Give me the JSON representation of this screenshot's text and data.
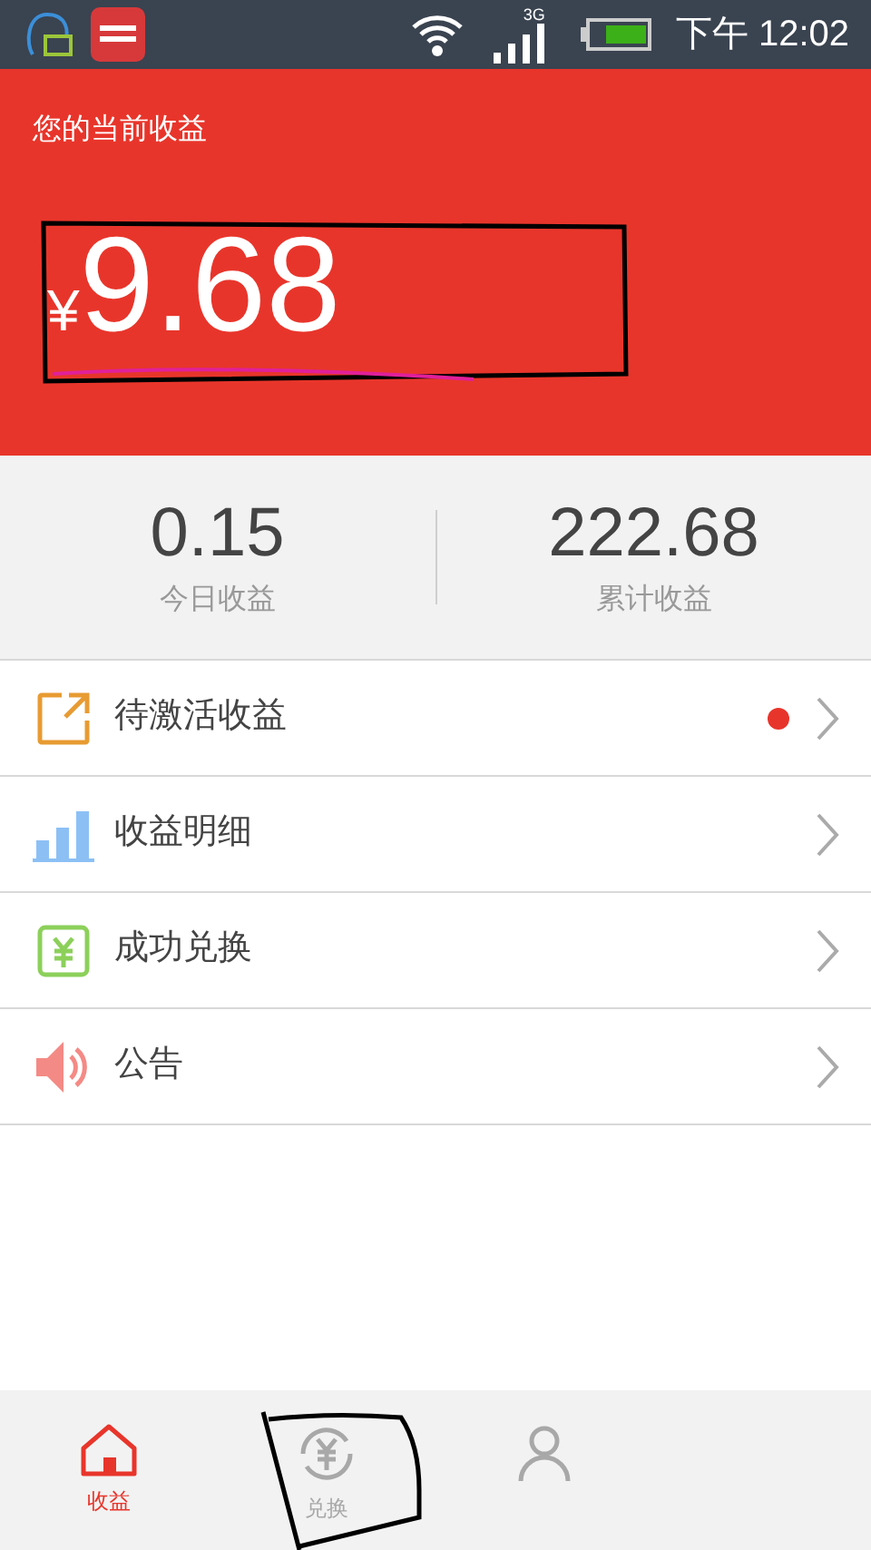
{
  "status_bar": {
    "time": "下午 12:02",
    "network": "3G"
  },
  "header": {
    "title": "您的当前收益",
    "currency": "¥",
    "amount": "9.68"
  },
  "stats": [
    {
      "value": "0.15",
      "label": "今日收益"
    },
    {
      "value": "222.68",
      "label": "累计收益"
    }
  ],
  "menu": [
    {
      "kind": "pending",
      "label": "待激活收益",
      "unread": true
    },
    {
      "kind": "details",
      "label": "收益明细",
      "unread": false
    },
    {
      "kind": "exchanged",
      "label": "成功兑换",
      "unread": false
    },
    {
      "kind": "notice",
      "label": "公告",
      "unread": false
    }
  ],
  "tabs": [
    {
      "kind": "home",
      "label": "收益",
      "selected": true
    },
    {
      "kind": "exchange",
      "label": "兑换",
      "selected": false
    },
    {
      "kind": "me",
      "selected": false
    }
  ]
}
